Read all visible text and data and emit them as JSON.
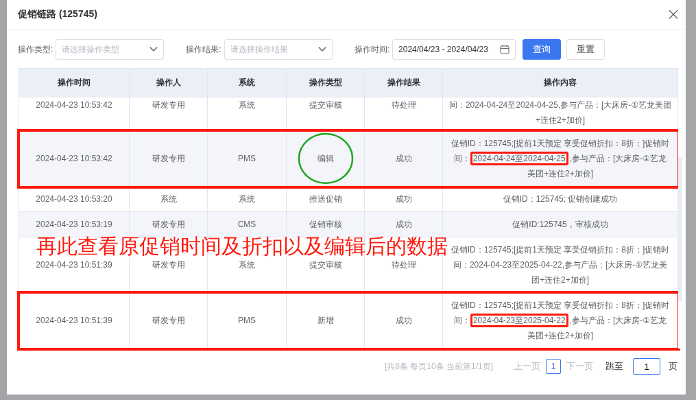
{
  "dialog": {
    "title": "促销链路 (125745)"
  },
  "filters": [
    {
      "kind": "select",
      "label": "操作类型:",
      "placeholder": "请选择操作类型"
    },
    {
      "kind": "select",
      "label": "操作结果:",
      "placeholder": "请选择操作结果"
    },
    {
      "kind": "date",
      "label": "操作时间:",
      "value": "2024/04/23 - 2024/04/23"
    }
  ],
  "buttons": [
    {
      "label": "查询",
      "kind": "primary"
    },
    {
      "label": "重置",
      "kind": "default"
    }
  ],
  "table": {
    "columns": [
      "操作时间",
      "操作人",
      "系统",
      "操作类型",
      "操作结果",
      "操作内容"
    ],
    "rows": [
      {
        "cells": [
          "2024-04-23 10:53:42",
          "研发专用",
          "系统",
          "提交审核",
          "待处理"
        ],
        "content": [
          "间：2024-04-24至2024-04-25,参与产品：[大床房-①艺龙美团+连住2+加价]"
        ],
        "boxed": false,
        "circled": false,
        "striped": false
      },
      {
        "cells": [
          "2024-04-23 10:53:42",
          "研发专用",
          "PMS",
          "编辑",
          "成功"
        ],
        "content": [
          "促销ID：125745;[提前1天预定 享受促销折扣：8折；]促销时间：",
          "2024-04-24至2024-04-25",
          ",参与产品：[大床房-①艺龙美团+连住2+加价]"
        ],
        "boxed": true,
        "circled": true,
        "striped": true
      },
      {
        "cells": [
          "2024-04-23 10:53:20",
          "系统",
          "系统",
          "推送促销",
          "成功"
        ],
        "content": [
          "促销ID：125745; 促销创建成功"
        ],
        "boxed": false,
        "circled": false,
        "striped": false
      },
      {
        "cells": [
          "2024-04-23 10:53:19",
          "研发专用",
          "CMS",
          "促销审核",
          "成功"
        ],
        "content": [
          "促销ID:125745，审核成功"
        ],
        "boxed": false,
        "circled": false,
        "striped": true
      },
      {
        "cells": [
          "2024-04-23 10:51:39",
          "研发专用",
          "系统",
          "提交审核",
          "待处理"
        ],
        "content": [
          "促销ID：125745;[提前1天预定 享受促销折扣：8折；]促销时间：2024-04-23至2025-04-22,参与产品：[大床房-①艺龙美团+连住2+加价]"
        ],
        "boxed": false,
        "circled": false,
        "striped": false
      },
      {
        "cells": [
          "2024-04-23 10:51:39",
          "研发专用",
          "PMS",
          "新增",
          "成功"
        ],
        "content": [
          "促销ID：125745;[提前1天预定 享受促销折扣：8折；]促销时间：",
          "2024-04-23至2025-04-22",
          ",参与产品：[大床房-①艺龙美团+连住2+加价]"
        ],
        "boxed": true,
        "circled": false,
        "striped": false
      }
    ]
  },
  "annotation": "再此查看原促销时间及折扣以及编辑后的数据",
  "pagination": {
    "summary": "[共8条 每页10条 当前第1/1页]",
    "prev": "上一页",
    "pages": [
      {
        "label": "1",
        "selected": true
      }
    ],
    "next": "下一页",
    "jump_label": "跳至",
    "jump_value": "1",
    "unit": "页"
  }
}
